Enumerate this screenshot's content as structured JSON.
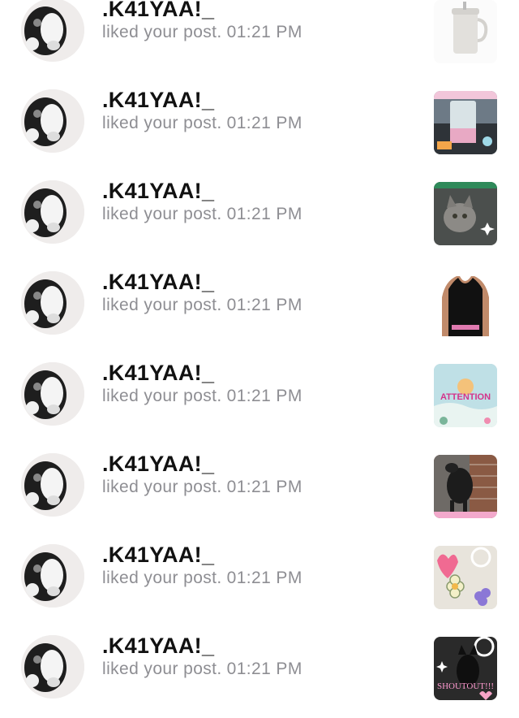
{
  "notifications": [
    {
      "user": ".K41YAA!_",
      "action": "liked your post.",
      "time": "01:21 PM",
      "thumb_icon": "tumbler-image"
    },
    {
      "user": ".K41YAA!_",
      "action": "liked your post.",
      "time": "01:21 PM",
      "thumb_icon": "drink-cup-image"
    },
    {
      "user": ".K41YAA!_",
      "action": "liked your post.",
      "time": "01:21 PM",
      "thumb_icon": "kitten-image"
    },
    {
      "user": ".K41YAA!_",
      "action": "liked your post.",
      "time": "01:21 PM",
      "thumb_icon": "tank-top-image"
    },
    {
      "user": ".K41YAA!_",
      "action": "liked your post.",
      "time": "01:21 PM",
      "thumb_icon": "attention-graphic-image",
      "thumb_text": "ATTENTION"
    },
    {
      "user": ".K41YAA!_",
      "action": "liked your post.",
      "time": "01:21 PM",
      "thumb_icon": "dog-image"
    },
    {
      "user": ".K41YAA!_",
      "action": "liked your post.",
      "time": "01:21 PM",
      "thumb_icon": "flowers-sticker-image"
    },
    {
      "user": ".K41YAA!_",
      "action": "liked your post.",
      "time": "01:21 PM",
      "thumb_icon": "black-cat-shoutout-image",
      "thumb_text": "SHOUTOUT!!!"
    }
  ],
  "avatar_icon": "husky-puppy-avatar"
}
